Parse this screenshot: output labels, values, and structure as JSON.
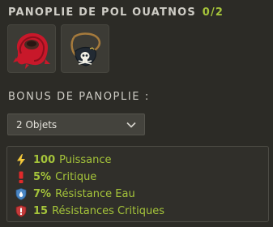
{
  "set": {
    "title": "PANOPLIE DE POL OUATNOS",
    "count": "0/2",
    "items": [
      {
        "icon": "red-cape-icon"
      },
      {
        "icon": "skull-amulet-icon"
      }
    ]
  },
  "bonus": {
    "title": "BONUS DE PANOPLIE :",
    "select_value": "2 Objets",
    "rows": [
      {
        "icon": "lightning-icon",
        "value": "100",
        "stat": "Puissance"
      },
      {
        "icon": "exclamation-icon",
        "value": "5%",
        "stat": "Critique"
      },
      {
        "icon": "water-shield-icon",
        "value": "7%",
        "stat": "Résistance Eau"
      },
      {
        "icon": "critical-shield-icon",
        "value": "15",
        "stat": "Résistances Critiques"
      }
    ]
  },
  "colors": {
    "accent_green": "#a5c43a",
    "background": "#2c2b26"
  }
}
